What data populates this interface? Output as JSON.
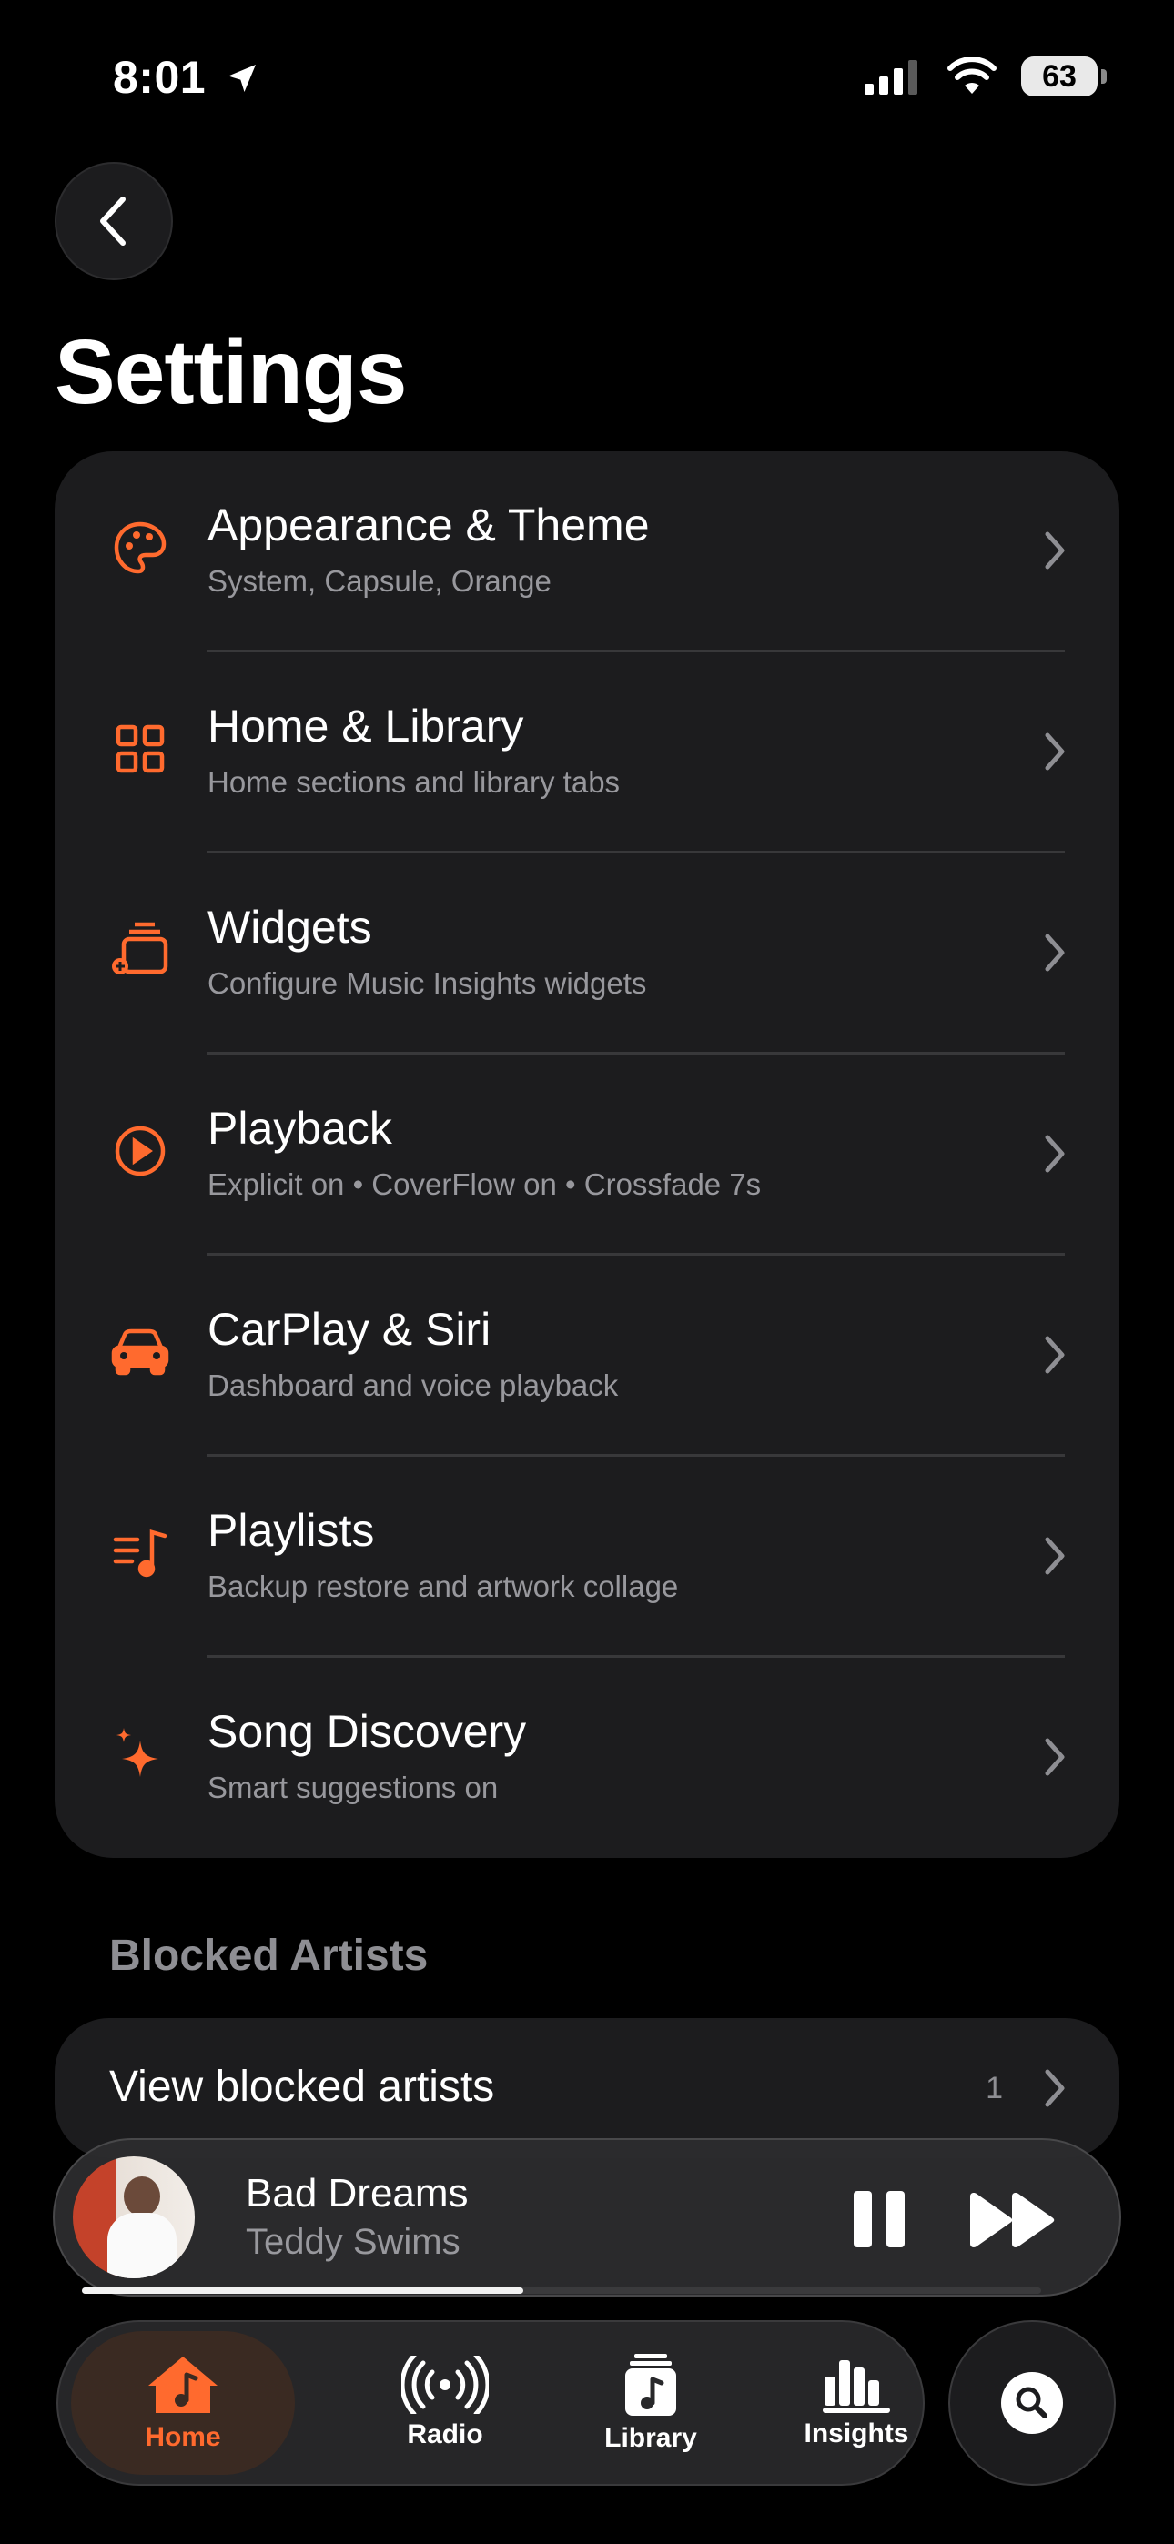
{
  "status_bar": {
    "time": "8:01",
    "battery": "63"
  },
  "header": {
    "title": "Settings"
  },
  "settings": [
    {
      "id": "appearance",
      "icon": "palette-icon",
      "label": "Appearance & Theme",
      "subtitle": "System, Capsule, Orange"
    },
    {
      "id": "home-library",
      "icon": "grid-icon",
      "label": "Home & Library",
      "subtitle": "Home sections and library tabs"
    },
    {
      "id": "widgets",
      "icon": "widgets-add-icon",
      "label": "Widgets",
      "subtitle": "Configure Music Insights widgets"
    },
    {
      "id": "playback",
      "icon": "play-circle-icon",
      "label": "Playback",
      "subtitle": "Explicit on • CoverFlow on • Crossfade 7s"
    },
    {
      "id": "carplay",
      "icon": "car-icon",
      "label": "CarPlay & Siri",
      "subtitle": "Dashboard and voice playback"
    },
    {
      "id": "playlists",
      "icon": "playlist-icon",
      "label": "Playlists",
      "subtitle": "Backup restore and artwork collage"
    },
    {
      "id": "discovery",
      "icon": "sparkles-icon",
      "label": "Song Discovery",
      "subtitle": "Smart suggestions on"
    }
  ],
  "blocked": {
    "section_title": "Blocked Artists",
    "label": "View blocked artists",
    "count": "1"
  },
  "now_playing": {
    "title": "Bad Dreams",
    "artist": "Teddy Swims",
    "progress": 0.46
  },
  "tabs": [
    {
      "label": "Home",
      "icon": "home-music-icon",
      "active": true
    },
    {
      "label": "Radio",
      "icon": "radio-broadcast-icon",
      "active": false
    },
    {
      "label": "Library",
      "icon": "library-icon",
      "active": false
    },
    {
      "label": "Insights",
      "icon": "insights-chart-icon",
      "active": false
    }
  ],
  "colors": {
    "accent": "#FF6A2E",
    "background": "#000000",
    "card": "#1C1C1E"
  }
}
